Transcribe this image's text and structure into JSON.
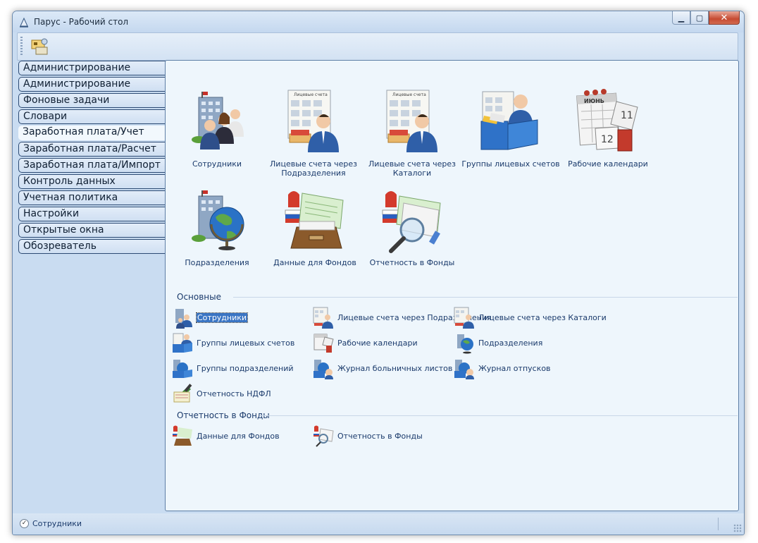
{
  "window": {
    "title": "Парус - Рабочий стол"
  },
  "nav": {
    "items": [
      "Администрирование сервера",
      "Администрирование",
      "Фоновые задачи",
      "Словари",
      "Заработная плата/Учет",
      "Заработная плата/Расчет",
      "Заработная плата/Импорт",
      "Контроль данных",
      "Учетная политика",
      "Настройки",
      "Открытые окна",
      "Обозреватель"
    ],
    "active_index": 4
  },
  "large_icons": [
    {
      "label": "Сотрудники",
      "icon": "employees-icon"
    },
    {
      "label": "Лицевые счета через Подразделения",
      "icon": "personal-accounts-icon"
    },
    {
      "label": "Лицевые счета через Каталоги",
      "icon": "personal-accounts-icon"
    },
    {
      "label": "Группы лицевых счетов",
      "icon": "account-groups-icon"
    },
    {
      "label": "Рабочие календари",
      "icon": "calendar-icon"
    },
    {
      "label": "Подразделения",
      "icon": "departments-globe-icon"
    },
    {
      "label": "Данные для Фондов",
      "icon": "fund-data-icon"
    },
    {
      "label": "Отчетность в Фонды",
      "icon": "fund-reporting-icon"
    }
  ],
  "sections": [
    {
      "title": "Основные",
      "items": [
        {
          "label": "Сотрудники",
          "selected": true
        },
        {
          "label": "Лицевые счета через Подразделения"
        },
        {
          "label": "Лицевые счета через Каталоги"
        },
        {
          "label": "Группы лицевых счетов"
        },
        {
          "label": "Рабочие календари"
        },
        {
          "label": "Подразделения"
        },
        {
          "label": "Группы подразделений"
        },
        {
          "label": "Журнал больничных листов"
        },
        {
          "label": "Журнал отпусков"
        },
        {
          "label": "Отчетность НДФЛ"
        }
      ]
    },
    {
      "title": "Отчетность в Фонды",
      "items": [
        {
          "label": "Данные для Фондов"
        },
        {
          "label": "Отчетность в Фонды"
        }
      ]
    }
  ],
  "status": {
    "text": "Сотрудники"
  },
  "colors": {
    "accent": "#3a75c4",
    "link": "#1a3a6b",
    "nav_border": "#2c4a73"
  }
}
